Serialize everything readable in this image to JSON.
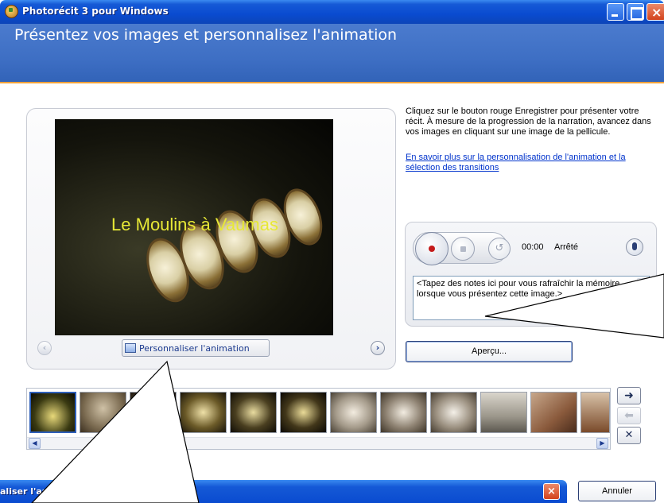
{
  "window": {
    "title": "Photorécit 3 pour Windows",
    "header_title": "Présentez vos images et personnalisez l'animation"
  },
  "preview": {
    "image_caption": "Le Moulins à Vaumas",
    "customize_button": "Personnaliser l'animation",
    "prev_icon": "chevron-left-icon",
    "next_icon": "chevron-right-icon"
  },
  "instructions": {
    "text": "Cliquez sur le bouton rouge Enregistrer pour présenter votre récit. À mesure de la progression de la narration, avancez dans vos images en cliquant sur une image de la pellicule.",
    "link": "En savoir plus sur la personnalisation de l'animation et la sélection des transitions"
  },
  "recorder": {
    "time": "00:00",
    "status": "Arrêté",
    "notes_placeholder": "<Tapez des notes ici pour vous rafraîchir la mémoire lorsque vous présentez cette image.>"
  },
  "buttons": {
    "preview": "Aperçu...",
    "cancel": "Annuler"
  },
  "filmstrip": {
    "thumbnail_count": 12,
    "selected_index": 0
  },
  "sub_window": {
    "title": "aliser l'animation"
  },
  "colors": {
    "titlebar": "#0a4bd0",
    "header": "#3e6fc4",
    "accent_line": "#f0a23a",
    "link": "#0033cc",
    "caption": "#e7e836"
  }
}
